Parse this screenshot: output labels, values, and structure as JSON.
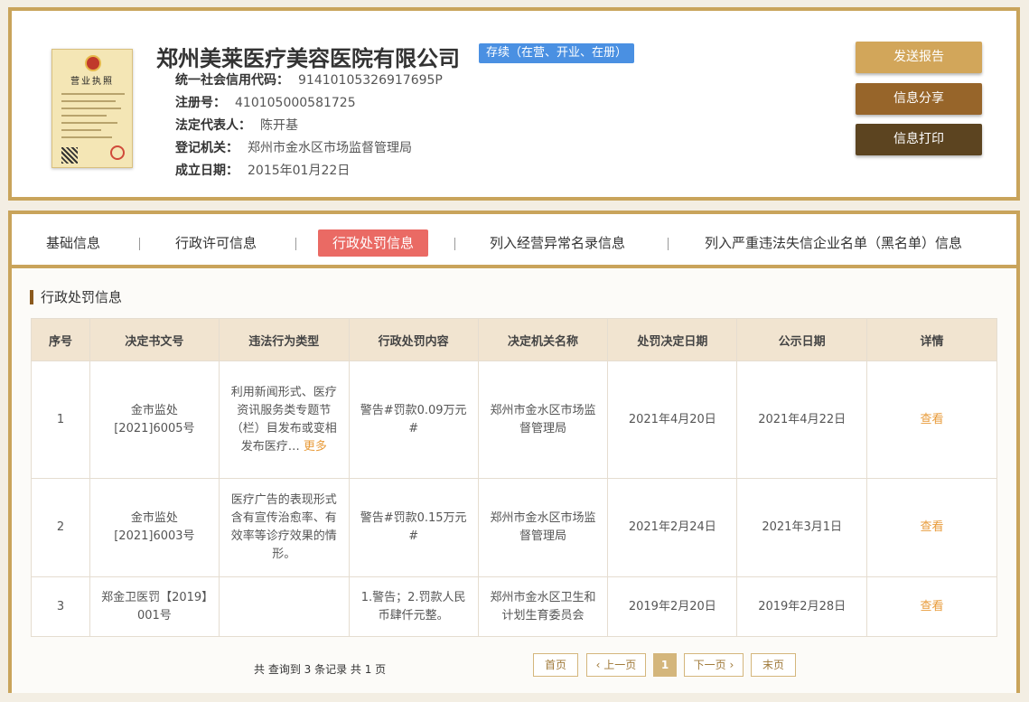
{
  "company": {
    "name": "郑州美莱医疗美容医院有限公司",
    "status": "存续（在营、开业、在册）",
    "license_image": {
      "title": "营业执照"
    },
    "fields": [
      {
        "label": "统一社会信用代码：",
        "value": "91410105326917695P"
      },
      {
        "label": "注册号：",
        "value": "410105000581725"
      },
      {
        "label": "法定代表人：",
        "value": "陈开基"
      },
      {
        "label": "登记机关：",
        "value": "郑州市金水区市场监督管理局"
      },
      {
        "label": "成立日期：",
        "value": "2015年01月22日"
      }
    ]
  },
  "actions": [
    {
      "label": "发送报告",
      "color": "#d2a65a"
    },
    {
      "label": "信息分享",
      "color": "#97652a"
    },
    {
      "label": "信息打印",
      "color": "#5c4420"
    }
  ],
  "tabs": [
    {
      "label": "基础信息"
    },
    {
      "label": "行政许可信息"
    },
    {
      "label": "行政处罚信息"
    },
    {
      "label": "列入经营异常名录信息"
    },
    {
      "label": "列入严重违法失信企业名单（黑名单）信息"
    }
  ],
  "section": {
    "title": "行政处罚信息"
  },
  "table": {
    "headers": [
      "序号",
      "决定书文号",
      "违法行为类型",
      "行政处罚内容",
      "决定机关名称",
      "处罚决定日期",
      "公示日期",
      "详情"
    ],
    "rows": [
      {
        "index": "1",
        "doc_no": "金市监处[2021]6005号",
        "violation": "利用新闻形式、医疗资讯服务类专题节（栏）目发布或变相发布医疗…",
        "more": "更多",
        "penalty": "警告#罚款0.09万元#",
        "authority": "郑州市金水区市场监督管理局",
        "decision_date": "2021年4月20日",
        "publish_date": "2021年4月22日",
        "detail": "查看"
      },
      {
        "index": "2",
        "doc_no": "金市监处[2021]6003号",
        "violation": "医疗广告的表现形式含有宣传治愈率、有效率等诊疗效果的情形。",
        "more": "",
        "penalty": "警告#罚款0.15万元#",
        "authority": "郑州市金水区市场监督管理局",
        "decision_date": "2021年2月24日",
        "publish_date": "2021年3月1日",
        "detail": "查看"
      },
      {
        "index": "3",
        "doc_no": "郑金卫医罚【2019】001号",
        "violation": "",
        "more": "",
        "penalty": "1.警告；2.罚款人民币肆仟元整。",
        "authority": "郑州市金水区卫生和计划生育委员会",
        "decision_date": "2019年2月20日",
        "publish_date": "2019年2月28日",
        "detail": "查看"
      }
    ]
  },
  "pagination": {
    "summary": "共 查询到 3 条记录 共 1 页",
    "first": "首页",
    "prev": "上一页",
    "current": "1",
    "next": "下一页",
    "last": "末页"
  }
}
